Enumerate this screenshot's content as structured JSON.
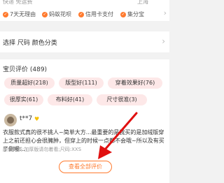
{
  "shipping": {
    "label": "快递 免运费",
    "right": "上海"
  },
  "guarantees": [
    "7天无理由",
    "蚂蚁花呗",
    "信用卡支付",
    "集分宝"
  ],
  "select": {
    "label": "选择 尺码 颜色分类"
  },
  "reviews": {
    "title": "宝贝评价 (489)",
    "tags": [
      "质量超好(218)",
      "版型好(111)",
      "穿着效果好(76)",
      "很厚实(61)",
      "布料好(41)",
      "尺寸很准(3)"
    ],
    "item": {
      "user": "t**7",
      "text": "衣服款式真的很不挑人~简单大方...最重要的是我买的是加绒版穿上之前还担心会很臃肿，但穿上的时候一点都不会哦~所以及有买了倒暖...",
      "sku": "颜色分类:加厚版请勿着看;尺码:XXS"
    },
    "view_all": "查看全部评价"
  },
  "colors": {
    "accent": "#ff7a2e",
    "tag_bg": "#fde8e8",
    "arrow": "#e01010"
  }
}
